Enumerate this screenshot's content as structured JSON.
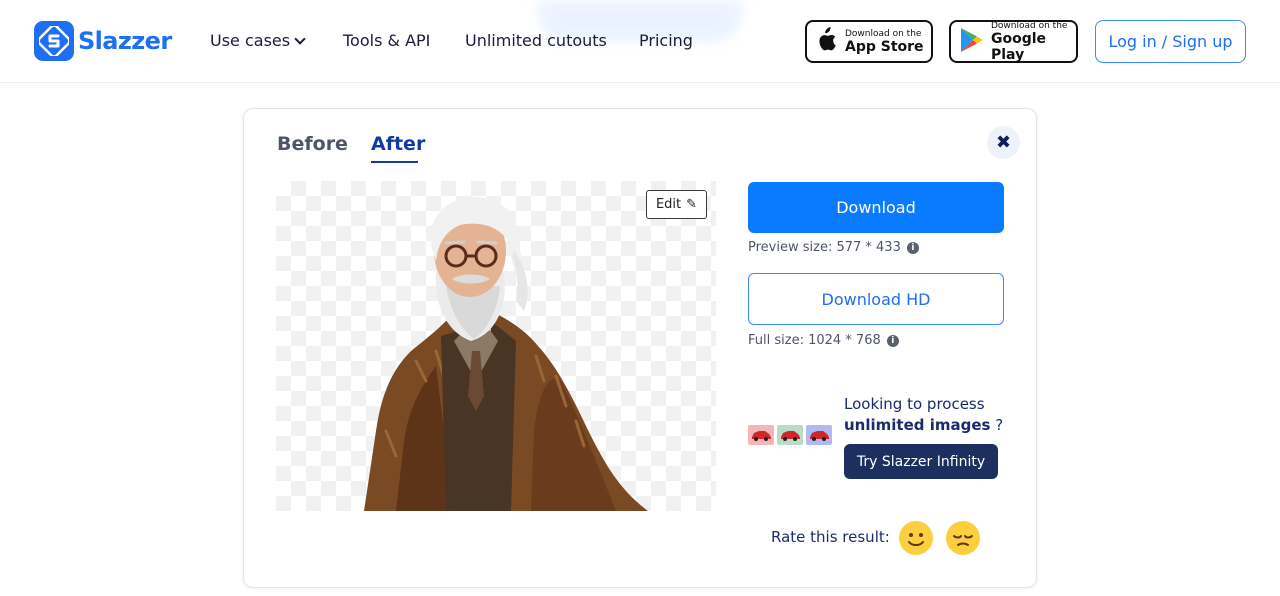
{
  "brand": {
    "name": "Slazzer",
    "accent": "#1f6ff2"
  },
  "nav": {
    "use_cases": "Use cases",
    "tools_api": "Tools & API",
    "unlimited_cutouts": "Unlimited cutouts",
    "pricing": "Pricing"
  },
  "stores": {
    "app_store": {
      "small": "Download on the",
      "big": "App Store",
      "icon": "apple-icon"
    },
    "google_play": {
      "small": "Download on the",
      "big": "Google Play",
      "icon": "google-play-icon"
    }
  },
  "auth": {
    "login_label": "Log in / Sign up"
  },
  "card": {
    "tabs": {
      "before": "Before",
      "after": "After",
      "active": "After"
    },
    "close_icon": "close-icon",
    "edit_label": "Edit",
    "download_label": "Download",
    "preview_size": "Preview size: 577 * 433",
    "download_hd_label": "Download HD",
    "full_size": "Full size: 1024 * 768",
    "promo": {
      "line1": "Looking to process",
      "line2_bold": "unlimited images",
      "line2_rest": " ?",
      "button": "Try Slazzer Infinity"
    },
    "rate_label": "Rate this result:",
    "rate_icons": [
      "smile-icon",
      "unamused-icon"
    ]
  },
  "colors": {
    "primary_button": "#0a7bff",
    "dark_button": "#1c2f5e",
    "tab_active": "#1139a8"
  }
}
